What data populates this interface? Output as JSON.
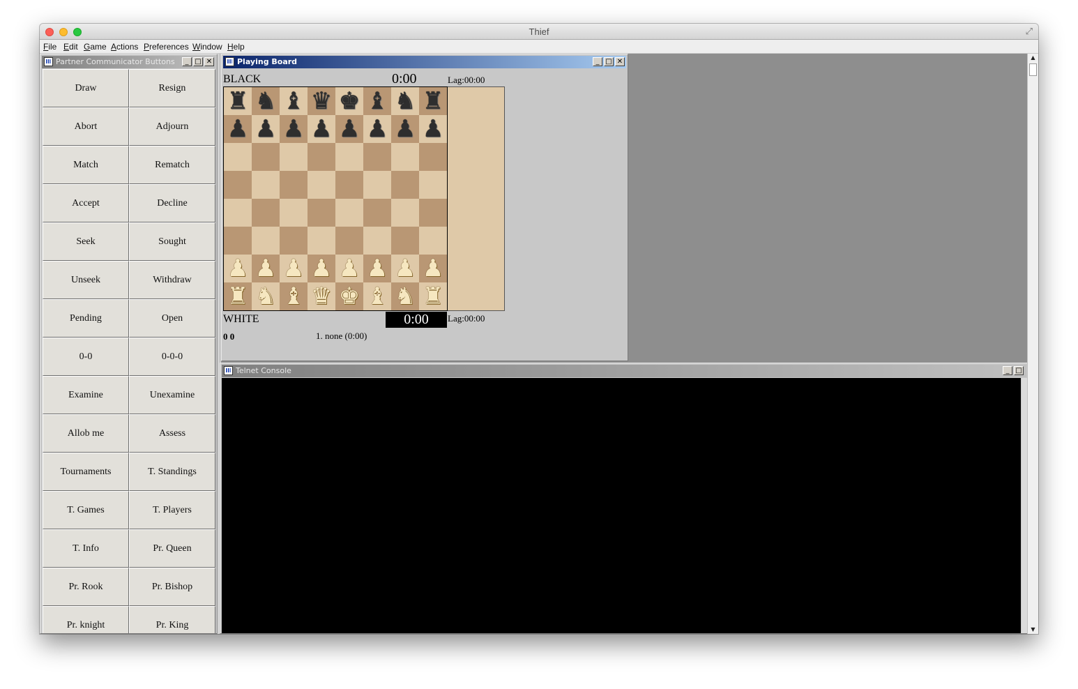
{
  "window": {
    "title": "Thief",
    "fullscreen_icon": "⤢"
  },
  "menubar": {
    "items": [
      "File",
      "Edit",
      "Game",
      "Actions",
      "Preferences",
      "Window",
      "Help"
    ]
  },
  "partner_frame": {
    "title": "Partner Communicator Buttons",
    "buttons": [
      [
        "Draw",
        "Resign"
      ],
      [
        "Abort",
        "Adjourn"
      ],
      [
        "Match",
        "Rematch"
      ],
      [
        "Accept",
        "Decline"
      ],
      [
        "Seek",
        "Sought"
      ],
      [
        "Unseek",
        "Withdraw"
      ],
      [
        "Pending",
        "Open"
      ],
      [
        "0-0",
        "0-0-0"
      ],
      [
        "Examine",
        "Unexamine"
      ],
      [
        "Allob me",
        "Assess"
      ],
      [
        "Tournaments",
        "T. Standings"
      ],
      [
        "T. Games",
        "T. Players"
      ],
      [
        "T. Info",
        "Pr. Queen"
      ],
      [
        "Pr. Rook",
        "Pr. Bishop"
      ],
      [
        "Pr. knight",
        "Pr. King"
      ]
    ]
  },
  "frame_controls": {
    "minimize": "_",
    "maximize": "□",
    "close": "✕"
  },
  "playing_board": {
    "title": "Playing Board",
    "black_label": "BLACK",
    "black_clock": "0:00",
    "lag_top": "Lag:00:00",
    "white_label": "WHITE",
    "white_clock": "0:00",
    "lag_bottom": "Lag:00:00",
    "score": "0 0",
    "move_text": "1. none (0:00)",
    "position": [
      [
        "r",
        "n",
        "b",
        "q",
        "k",
        "b",
        "n",
        "r"
      ],
      [
        "p",
        "p",
        "p",
        "p",
        "p",
        "p",
        "p",
        "p"
      ],
      [
        "",
        "",
        "",
        "",
        "",
        "",
        "",
        ""
      ],
      [
        "",
        "",
        "",
        "",
        "",
        "",
        "",
        ""
      ],
      [
        "",
        "",
        "",
        "",
        "",
        "",
        "",
        ""
      ],
      [
        "",
        "",
        "",
        "",
        "",
        "",
        "",
        ""
      ],
      [
        "P",
        "P",
        "P",
        "P",
        "P",
        "P",
        "P",
        "P"
      ],
      [
        "R",
        "N",
        "B",
        "Q",
        "K",
        "B",
        "N",
        "R"
      ]
    ],
    "colors": {
      "light_square": "#dfc9a8",
      "dark_square": "#b99774"
    }
  },
  "telnet_console": {
    "title": "Telnet Console"
  },
  "scrollbar": {
    "up_arrow": "▲",
    "down_arrow": "▼"
  }
}
